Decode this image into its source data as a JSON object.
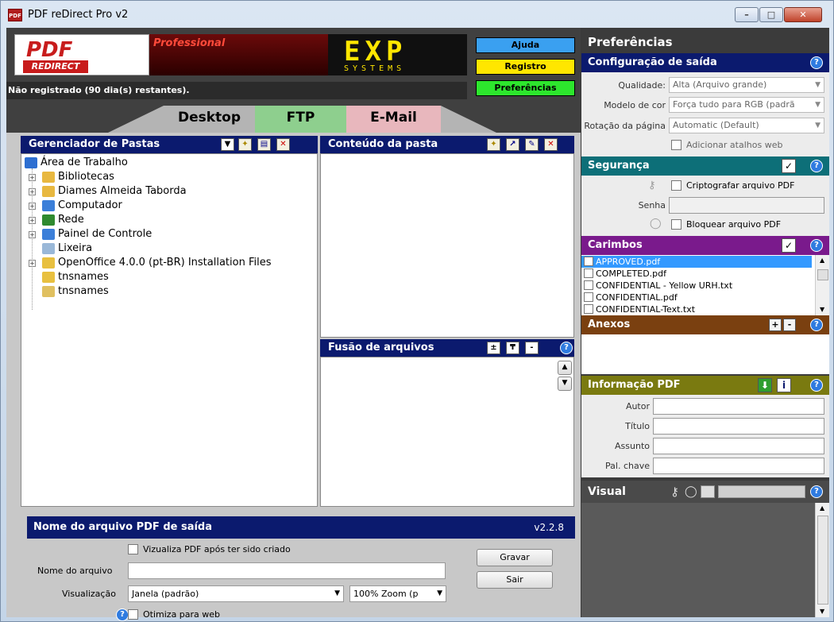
{
  "window": {
    "title": "PDF reDirect Pro v2",
    "icon_text": "PDF",
    "minimize": "–",
    "maximize": "□",
    "close": "✕"
  },
  "header": {
    "logo_pdf": "PDF",
    "logo_redirect": "REDIRECT",
    "logo_professional": "Professional",
    "logo_exp": "EXP",
    "logo_systems": "SYSTEMS",
    "registration_status": "Não registrado (90 dia(s) restantes).",
    "help_button": "Ajuda",
    "register_button": "Registro",
    "preferences_button": "Preferências"
  },
  "tabs": {
    "desktop": "Desktop",
    "ftp": "FTP",
    "email": "E-Mail"
  },
  "folder_manager": {
    "title": "Gerenciador de Pastas",
    "items": [
      {
        "label": "Área de Trabalho",
        "icon": "desktop-icon",
        "level": 0,
        "expandable": false
      },
      {
        "label": "Bibliotecas",
        "icon": "libraries-icon",
        "level": 1,
        "expandable": true
      },
      {
        "label": "Diames Almeida Taborda",
        "icon": "user-folder-icon",
        "level": 1,
        "expandable": true
      },
      {
        "label": "Computador",
        "icon": "computer-icon",
        "level": 1,
        "expandable": true
      },
      {
        "label": "Rede",
        "icon": "network-icon",
        "level": 1,
        "expandable": true
      },
      {
        "label": "Painel de Controle",
        "icon": "control-panel-icon",
        "level": 1,
        "expandable": true
      },
      {
        "label": "Lixeira",
        "icon": "recycle-bin-icon",
        "level": 1,
        "expandable": false
      },
      {
        "label": "OpenOffice 4.0.0 (pt-BR) Installation Files",
        "icon": "folder-icon",
        "level": 1,
        "expandable": true
      },
      {
        "label": "tnsnames",
        "icon": "folder-icon",
        "level": 1,
        "expandable": false
      },
      {
        "label": "tnsnames",
        "icon": "file-icon",
        "level": 1,
        "expandable": false
      }
    ]
  },
  "folder_content": {
    "title": "Conteúdo da pasta"
  },
  "merge": {
    "title": "Fusão de arquivos",
    "btn_add": "±",
    "btn_down": "₸",
    "btn_remove": "-",
    "help": "?"
  },
  "output": {
    "title": "Nome do arquivo PDF de saída",
    "version": "v2.2.8",
    "view_after_label": "Vizualiza PDF após ter sido criado",
    "filename_label": "Nome do arquivo",
    "filename_value": "",
    "view_label": "Visualização",
    "view_value": "Janela (padrão)",
    "zoom_value": "100% Zoom (p",
    "optimize_label": "Otimiza para web",
    "save_button": "Gravar",
    "exit_button": "Sair"
  },
  "preferences": {
    "title": "Preferências",
    "output_config": {
      "title": "Configuração de saída",
      "quality_label": "Qualidade:",
      "quality_value": "Alta (Arquivo grande)",
      "color_label": "Modelo de cor",
      "color_value": "Força tudo para RGB (padrã",
      "rotation_label": "Rotação da página",
      "rotation_value": "Automatic (Default)",
      "web_shortcuts_label": "Adicionar atalhos web"
    },
    "security": {
      "title": "Segurança",
      "encrypt_label": "Criptografar arquivo PDF",
      "password_label": "Senha",
      "lock_label": "Bloquear arquivo PDF"
    },
    "stamps": {
      "title": "Carimbos",
      "items": [
        "APPROVED.pdf",
        "COMPLETED.pdf",
        "CONFIDENTIAL - Yellow URH.txt",
        "CONFIDENTIAL.pdf",
        "CONFIDENTIAL-Text.txt"
      ],
      "selected_index": 0
    },
    "attachments": {
      "title": "Anexos",
      "add": "+",
      "remove": "-"
    },
    "pdf_info": {
      "title": "Informação PDF",
      "author_label": "Autor",
      "title_label": "Título",
      "subject_label": "Assunto",
      "keywords_label": "Pal. chave"
    },
    "visual": {
      "title": "Visual"
    }
  },
  "colors": {
    "panel_navy": "#0b1a6e",
    "security_teal": "#0d6f78",
    "stamps_purple": "#7a1a8c",
    "attachments_brown": "#7a4010",
    "pdfinfo_olive": "#7a7a10",
    "help_blue": "#3aa0f0",
    "register_yellow": "#ffe600",
    "prefs_green": "#2de62d"
  }
}
